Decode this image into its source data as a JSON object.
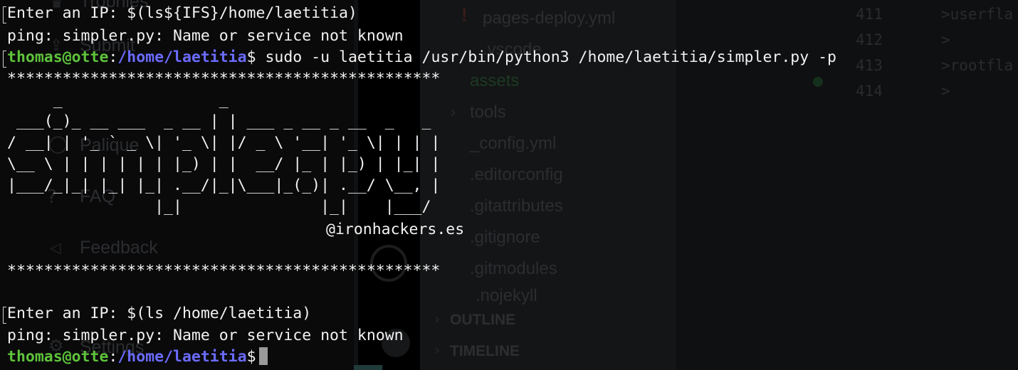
{
  "background": {
    "left_panel": {
      "items": [
        "Trophies",
        "Submit",
        "Palique",
        "FAQ",
        "Feedback",
        "Settings"
      ],
      "icons": [
        "trophy-icon",
        "upload-icon",
        "chat-icon",
        "question-icon",
        "speaker-icon",
        "gear-icon"
      ]
    },
    "explorer": {
      "files": [
        "pages-deploy.yml",
        ".vscode",
        "assets",
        "tools",
        "_config.yml",
        ".editorconfig",
        ".gitattributes",
        ".gitignore",
        ".gitmodules",
        ".nojekyll"
      ],
      "sections": [
        "OUTLINE",
        "TIMELINE"
      ]
    },
    "editor": {
      "line_numbers": [
        "411",
        "412",
        "413",
        "414"
      ],
      "lines": [
        ">userfla",
        ">",
        ">rootfla",
        ">"
      ]
    },
    "colors": {
      "folder_green": "#1d3a23",
      "ghost_text": "#2b2d30"
    }
  },
  "terminal": {
    "colors": {
      "background": "#000000",
      "text": "#f2f2f2",
      "user_host": "#5ec33b",
      "path": "#6b6bff",
      "cursor": "#9a9a9a"
    },
    "prompt": {
      "user_host": "thomas@otte",
      "separator": ":",
      "path": "/home/laetitia",
      "dollar": "$"
    },
    "lines": {
      "l1": "Enter an IP: $(ls${IFS}/home/laetitia)",
      "l2": "ping: simpler.py: Name or service not known",
      "l3_command": " sudo -u laetitia /usr/bin/python3 /home/laetitia/simpler.py -p",
      "stars": "***********************************************",
      "handle": "@ironhackers.es",
      "l_enter2": "Enter an IP: $(ls /home/laetitia)",
      "l_ping2": "ping: simpler.py: Name or service not known"
    },
    "banner_art": "     _                 _\n ___(_)_ __ ___  _ __ | | ___ _ __ _ __  _   _\n/ __| | '_ ` _ \\| '_ \\| |/ _ \\ '__| '_ \\| | | |\n\\__ \\ | | | | | | |_) | |  __/ |_ | |_) | |_| |\n|___/_|_| |_| |_| .__/|_|\\___|_(_)| .__/ \\__, |\n                |_|               |_|    |___/"
  }
}
